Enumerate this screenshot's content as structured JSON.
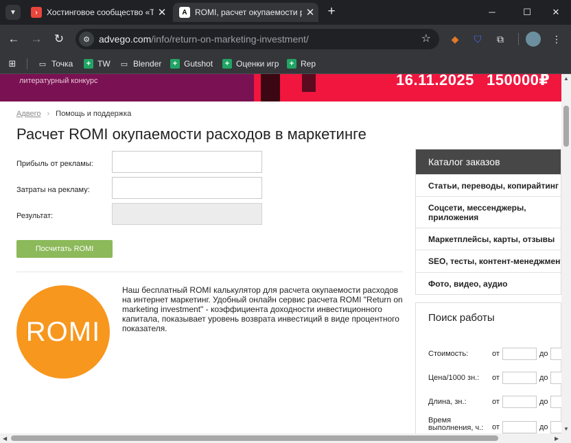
{
  "browser": {
    "tabs": [
      {
        "title": "Хостинговое сообщество «Tim",
        "favicon": "›",
        "favicon_color": "#e8453c",
        "active": false
      },
      {
        "title": "ROMI, расчет окупаемости рас",
        "favicon": "A",
        "favicon_color": "#000000",
        "active": true
      }
    ],
    "new_tab_label": "+",
    "url_domain": "advego.com",
    "url_path": "/info/return-on-marketing-investment/",
    "bookmarks": [
      {
        "label": "Точка",
        "icon": "folder-icon"
      },
      {
        "label": "TW",
        "icon": "green-bookmark-icon"
      },
      {
        "label": "Blender",
        "icon": "folder-icon"
      },
      {
        "label": "Gutshot",
        "icon": "green-bookmark-icon"
      },
      {
        "label": "Оценки игр",
        "icon": "green-bookmark-icon"
      },
      {
        "label": "Rep",
        "icon": "green-bookmark-icon"
      }
    ]
  },
  "banner": {
    "subtitle": "литературный конкурс",
    "date": "16.11.2025",
    "prize": "150000₽"
  },
  "breadcrumb": {
    "home": "Адвего",
    "current": "Помощь и поддержка"
  },
  "page_title": "Расчет ROMI окупаемости расходов в маркетинге",
  "form": {
    "profit_label": "Прибыль от рекламы:",
    "profit_value": "",
    "cost_label": "Затраты на рекламу:",
    "cost_value": "",
    "result_label": "Результат:",
    "result_value": "",
    "calc_button": "Посчитать ROMI"
  },
  "logo_text": "ROMI",
  "description": "Наш бесплатный ROMI калькулятор для расчета окупаемости расходов на интернет маркетинг. Удобный онлайн сервис расчета ROMI \"Return on marketing investment\" - коэффициента доходности инвестиционного капитала, показывает уровень возврата инвестиций в виде процентного показателя.",
  "catalog": {
    "title": "Каталог заказов",
    "items": [
      "Статьи, переводы, копирайтинг",
      "Соцсети, мессенджеры, приложения",
      "Маркетплейсы, карты, отзывы",
      "SEO, тесты, контент-менеджмент",
      "Фото, видео, аудио"
    ]
  },
  "job_search": {
    "title": "Поиск работы",
    "from_label": "от",
    "to_label": "до",
    "filters": [
      {
        "label": "Стоимость:"
      },
      {
        "label": "Цена/1000 зн.:"
      },
      {
        "label": "Длина, зн.:"
      },
      {
        "label_line1": "Время",
        "label_line2": "выполнения, ч.:"
      }
    ]
  },
  "colors": {
    "accent_green": "#8cb95a",
    "logo_orange": "#f7971e",
    "banner_red": "#f0163e",
    "catalog_header": "#474747"
  }
}
